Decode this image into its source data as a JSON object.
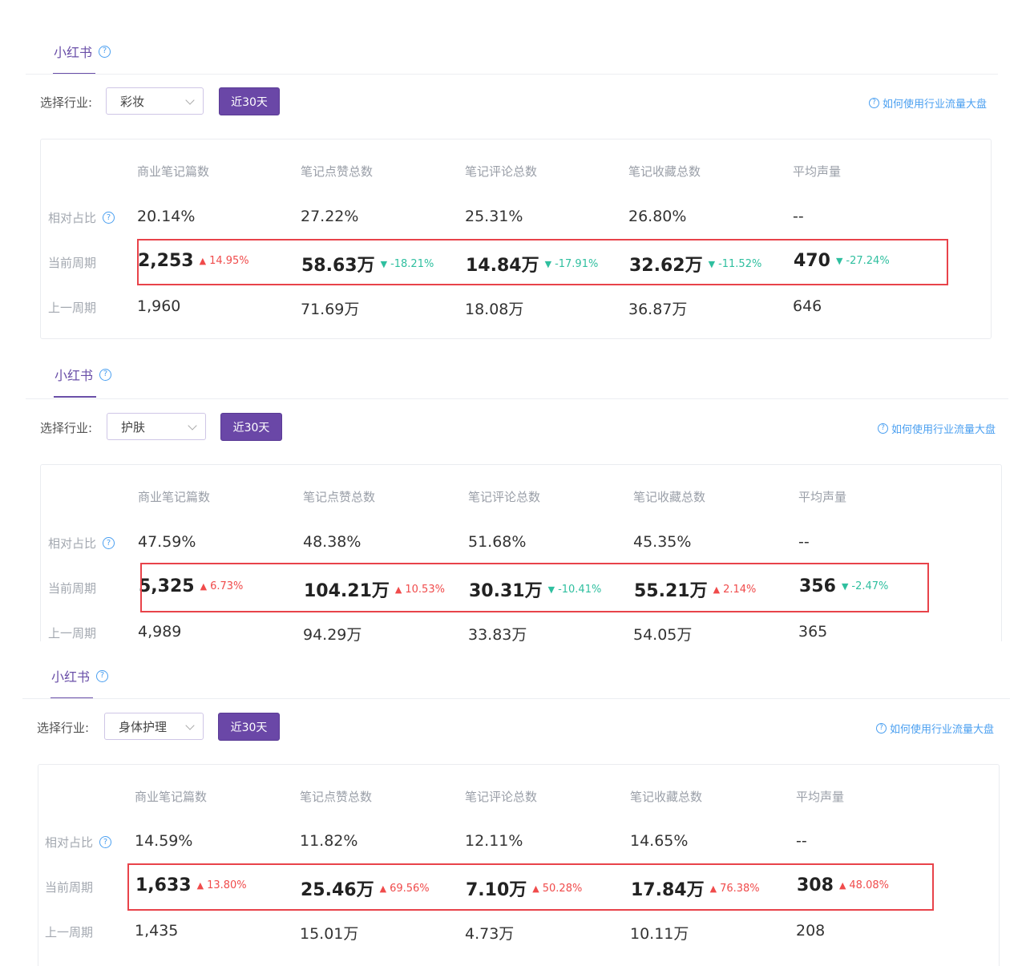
{
  "panels": [
    {
      "tab_label": "小红书",
      "industry_label": "选择行业:",
      "industry_value": "彩妆",
      "range_button": "近30天",
      "help_link": "如何使用行业流量大盘",
      "columns": [
        "商业笔记篇数",
        "笔记点赞总数",
        "笔记评论总数",
        "笔记收藏总数",
        "平均声量"
      ],
      "row_labels": {
        "ratio": "相对占比",
        "current": "当前周期",
        "previous": "上一周期"
      },
      "ratio": [
        "20.14%",
        "27.22%",
        "25.31%",
        "26.80%",
        "--"
      ],
      "current": [
        {
          "value": "2,253",
          "change": "14.95%",
          "dir": "up"
        },
        {
          "value": "58.63万",
          "change": "-18.21%",
          "dir": "down"
        },
        {
          "value": "14.84万",
          "change": "-17.91%",
          "dir": "down"
        },
        {
          "value": "32.62万",
          "change": "-11.52%",
          "dir": "down"
        },
        {
          "value": "470",
          "change": "-27.24%",
          "dir": "down"
        }
      ],
      "previous": [
        "1,960",
        "71.69万",
        "18.08万",
        "36.87万",
        "646"
      ]
    },
    {
      "tab_label": "小红书",
      "industry_label": "选择行业:",
      "industry_value": "护肤",
      "range_button": "近30天",
      "help_link": "如何使用行业流量大盘",
      "columns": [
        "商业笔记篇数",
        "笔记点赞总数",
        "笔记评论总数",
        "笔记收藏总数",
        "平均声量"
      ],
      "row_labels": {
        "ratio": "相对占比",
        "current": "当前周期",
        "previous": "上一周期"
      },
      "ratio": [
        "47.59%",
        "48.38%",
        "51.68%",
        "45.35%",
        "--"
      ],
      "current": [
        {
          "value": "5,325",
          "change": "6.73%",
          "dir": "up"
        },
        {
          "value": "104.21万",
          "change": "10.53%",
          "dir": "up"
        },
        {
          "value": "30.31万",
          "change": "-10.41%",
          "dir": "down"
        },
        {
          "value": "55.21万",
          "change": "2.14%",
          "dir": "up"
        },
        {
          "value": "356",
          "change": "-2.47%",
          "dir": "down"
        }
      ],
      "previous": [
        "4,989",
        "94.29万",
        "33.83万",
        "54.05万",
        "365"
      ]
    },
    {
      "tab_label": "小红书",
      "industry_label": "选择行业:",
      "industry_value": "身体护理",
      "range_button": "近30天",
      "help_link": "如何使用行业流量大盘",
      "columns": [
        "商业笔记篇数",
        "笔记点赞总数",
        "笔记评论总数",
        "笔记收藏总数",
        "平均声量"
      ],
      "row_labels": {
        "ratio": "相对占比",
        "current": "当前周期",
        "previous": "上一周期"
      },
      "ratio": [
        "14.59%",
        "11.82%",
        "12.11%",
        "14.65%",
        "--"
      ],
      "current": [
        {
          "value": "1,633",
          "change": "13.80%",
          "dir": "up"
        },
        {
          "value": "25.46万",
          "change": "69.56%",
          "dir": "up"
        },
        {
          "value": "7.10万",
          "change": "50.28%",
          "dir": "up"
        },
        {
          "value": "17.84万",
          "change": "76.38%",
          "dir": "up"
        },
        {
          "value": "308",
          "change": "48.08%",
          "dir": "up"
        }
      ],
      "previous": [
        "1,435",
        "15.01万",
        "4.73万",
        "10.11万",
        "208"
      ]
    }
  ],
  "colors": {
    "accent": "#6a47a7",
    "link": "#4a9ff0",
    "up": "#f04b4b",
    "down": "#2fbf9f",
    "highlight_border": "#e8434a"
  },
  "icons": {
    "help": "question-circle-icon",
    "dropdown": "chevron-down-icon",
    "up": "triangle-up-icon",
    "down": "triangle-down-icon"
  }
}
